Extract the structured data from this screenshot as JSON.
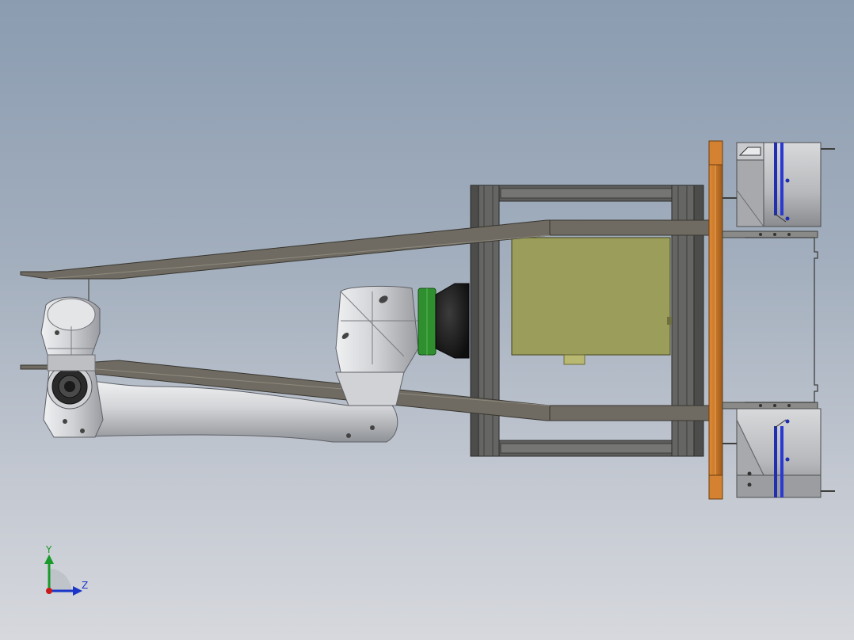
{
  "viewport": {
    "background_top": "#8b9cb1",
    "background_bottom": "#d6d8dd"
  },
  "triad": {
    "y_label": "Y",
    "z_label": "Z",
    "y_color": "#1a9a2a",
    "z_color": "#1a36c8",
    "x_color": "#c81a1a"
  },
  "colors": {
    "frame_steel": "#5b5c5a",
    "frame_dark": "#3d3e3c",
    "rail": "#6f6b62",
    "arm_light": "#d6d7d9",
    "arm_shadow": "#8e9095",
    "flange_green": "#2f8f2f",
    "wrist_black": "#1b1b1b",
    "box_olive": "#9b9d5b",
    "plate_orange": "#c77728",
    "gripper_grey": "#b9babc",
    "stripe_blue": "#1f2fb0"
  }
}
